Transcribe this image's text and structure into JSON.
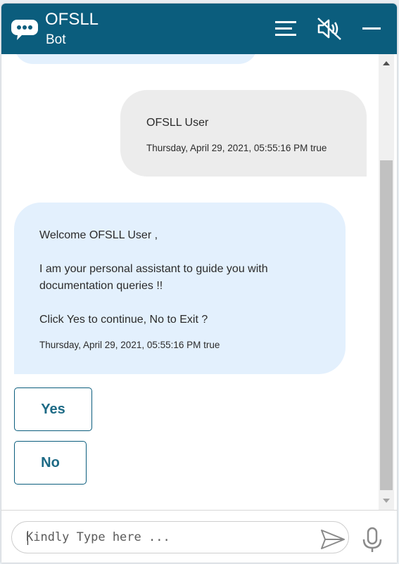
{
  "header": {
    "title": "OFSLL",
    "subtitle": "Bot",
    "icons": {
      "logo": "chat-bubble-icon",
      "menu": "menu-icon",
      "mute": "speaker-muted-icon",
      "minimize": "minimize-icon"
    }
  },
  "conversation": {
    "user_message": {
      "text": "OFSLL User",
      "timestamp": "Thursday, April 29, 2021, 05:55:16 PM true"
    },
    "bot_message": {
      "lines": [
        "Welcome OFSLL User ,",
        "I am your personal assistant to guide you with",
        "documentation queries !!",
        "Click Yes to continue, No to Exit ?"
      ],
      "timestamp": "Thursday, April 29, 2021, 05:55:16 PM true"
    },
    "choices": [
      {
        "label": "Yes"
      },
      {
        "label": "No"
      }
    ]
  },
  "composer": {
    "placeholder": "Kindly Type here ...",
    "value": "",
    "send_icon": "send-icon",
    "mic_icon": "microphone-icon"
  },
  "colors": {
    "header_bg": "#0b5d7d",
    "user_bubble": "#ececec",
    "bot_bubble": "#e3f0fd",
    "choice_text": "#1d6a85"
  }
}
